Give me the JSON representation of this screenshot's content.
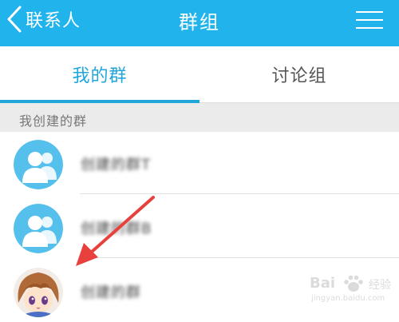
{
  "header": {
    "back_label": "联系人",
    "title": "群组",
    "background_color": "#21b4ec",
    "menu_icon": "hamburger-menu-icon"
  },
  "tabs": [
    {
      "label": "我的群",
      "active": true
    },
    {
      "label": "讨论组",
      "active": false
    }
  ],
  "accent_color": "#21a6dc",
  "section": {
    "label": "我创建的群"
  },
  "groups": [
    {
      "name": "创建的群T",
      "avatar": "default-group-avatar-icon",
      "name_blurred": true
    },
    {
      "name": "创建的群B",
      "avatar": "default-group-avatar-icon",
      "name_blurred": true
    },
    {
      "name": "创建的群",
      "avatar": "anime-girl-avatar",
      "name_blurred": true
    }
  ],
  "annotation": {
    "type": "arrow",
    "color": "#e8403c",
    "points_to": "groups.2.avatar"
  },
  "watermark": {
    "brand": "Bai",
    "brand_suffix": "经验",
    "url": "jingyan.baidu.com"
  }
}
